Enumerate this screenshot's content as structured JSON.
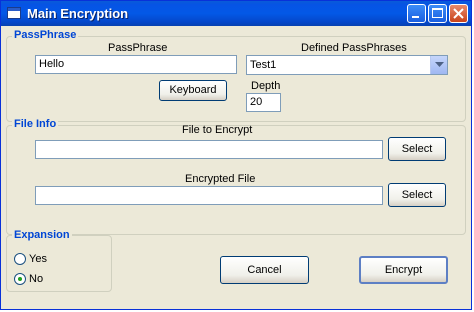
{
  "window": {
    "title": "Main Encryption"
  },
  "passphrase_group": {
    "legend": "PassPhrase",
    "passphrase_label": "PassPhrase",
    "passphrase_value": "Hello",
    "defined_label": "Defined PassPhrases",
    "defined_selected": "Test1",
    "keyboard_button": "Keyboard",
    "depth_label": "Depth",
    "depth_value": "20"
  },
  "file_group": {
    "legend": "File Info",
    "file_to_encrypt_label": "File to Encrypt",
    "file_to_encrypt_value": "",
    "select_button_1": "Select",
    "encrypted_file_label": "Encrypted File",
    "encrypted_file_value": "",
    "select_button_2": "Select"
  },
  "expansion_group": {
    "legend": "Expansion",
    "options": [
      {
        "label": "Yes",
        "checked": false
      },
      {
        "label": "No",
        "checked": true
      }
    ]
  },
  "actions": {
    "cancel": "Cancel",
    "encrypt": "Encrypt"
  },
  "icons": {
    "app": "window-icon",
    "minimize": "minimize-icon",
    "maximize": "maximize-icon",
    "close": "close-icon"
  }
}
